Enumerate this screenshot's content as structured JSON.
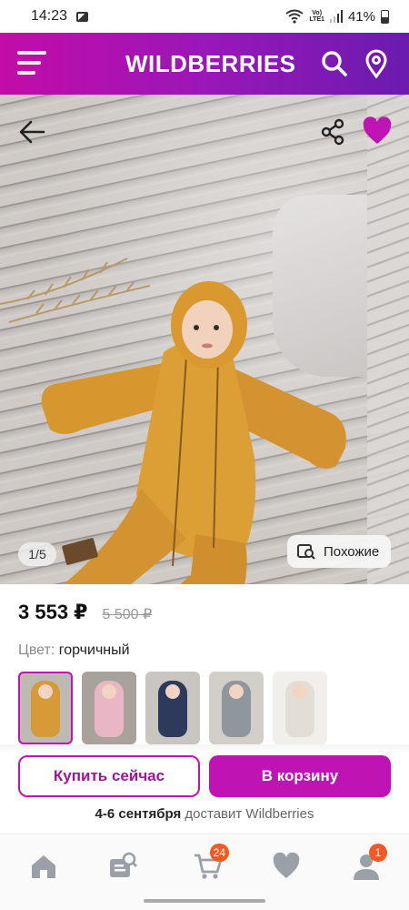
{
  "status_bar": {
    "time": "14:23",
    "network": "LTE1",
    "battery": "41%"
  },
  "header": {
    "logo": "WILDBERRIES"
  },
  "gallery": {
    "counter": "1/5",
    "similar_label": "Похожие"
  },
  "product": {
    "price": "3 553 ₽",
    "old_price": "5 500 ₽",
    "color_label": "Цвет:",
    "color_value": "горчичный",
    "swatches": [
      {
        "name": "mustard",
        "color": "#d69a36"
      },
      {
        "name": "pink",
        "color": "#e8b6c4"
      },
      {
        "name": "navy",
        "color": "#2e3a5c"
      },
      {
        "name": "grey",
        "color": "#8f969c"
      },
      {
        "name": "white",
        "color": "#ece9e4"
      }
    ]
  },
  "actions": {
    "buy_now": "Купить сейчас",
    "add_to_cart": "В корзину"
  },
  "delivery": {
    "date": "4-6 сентября",
    "text": "доставит Wildberries"
  },
  "bottom_nav": {
    "cart_badge": "24",
    "profile_badge": "1"
  },
  "colors": {
    "accent": "#c013b3",
    "badge": "#f35a23"
  }
}
